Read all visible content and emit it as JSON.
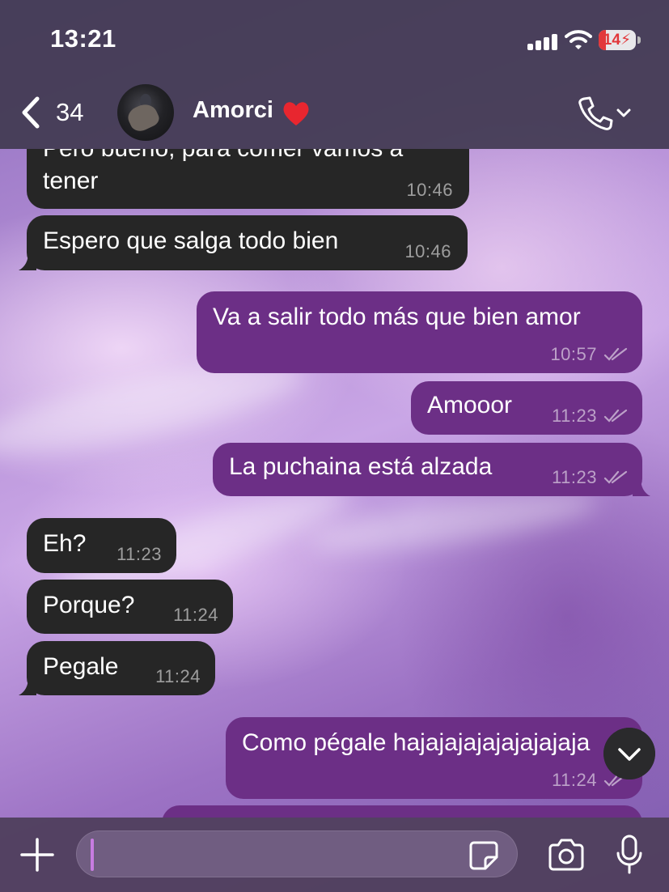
{
  "status_bar": {
    "time": "13:21",
    "battery": "14"
  },
  "header": {
    "back_count": "34",
    "contact_name": "Amorci"
  },
  "messages": [
    {
      "dir": "in",
      "text_partial": "Pero bueno, para comer vamos a",
      "text": "tener",
      "time": "10:46"
    },
    {
      "dir": "in",
      "text": "Espero que salga todo bien",
      "time": "10:46"
    },
    {
      "dir": "out",
      "text": "Va a salir todo más que bien amor",
      "time": "10:57"
    },
    {
      "dir": "out",
      "text": "Amooor",
      "time": "11:23"
    },
    {
      "dir": "out",
      "text": "La puchaina está alzada",
      "time": "11:23"
    },
    {
      "dir": "in",
      "text": "Eh?",
      "time": "11:23"
    },
    {
      "dir": "in",
      "text": "Porque?",
      "time": "11:24"
    },
    {
      "dir": "in",
      "text": "Pegale",
      "time": "11:24"
    },
    {
      "dir": "out",
      "text": "Como pégale hajajajajajajajajaja",
      "time": "11:24"
    }
  ],
  "composer": {
    "value": "",
    "placeholder": ""
  },
  "icons": {
    "back": "chevron-left-icon",
    "call": "phone-icon",
    "scroll_down": "chevron-down-icon",
    "attach": "plus-icon",
    "sticker": "sticker-icon",
    "camera": "camera-icon",
    "mic": "microphone-icon"
  },
  "colors": {
    "incoming_bubble": "#262626",
    "outgoing_bubble": "#6c2f86",
    "header_bg": "#423a52"
  }
}
